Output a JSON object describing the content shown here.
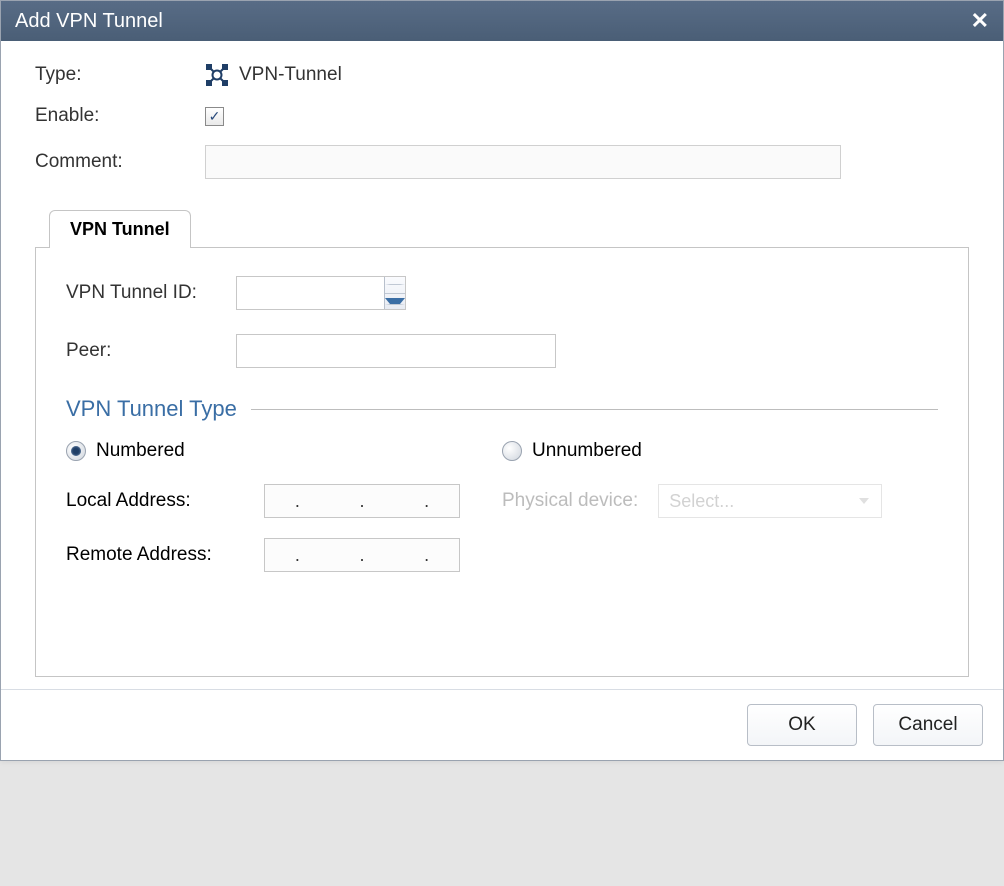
{
  "dialog": {
    "title": "Add VPN Tunnel"
  },
  "form": {
    "type_label": "Type:",
    "type_value": "VPN-Tunnel",
    "enable_label": "Enable:",
    "enable_checked": true,
    "comment_label": "Comment:",
    "comment_value": ""
  },
  "tab": {
    "label": "VPN Tunnel"
  },
  "panel": {
    "tunnel_id_label": "VPN Tunnel ID:",
    "tunnel_id_value": "",
    "peer_label": "Peer:",
    "peer_value": ""
  },
  "section": {
    "title": "VPN Tunnel Type"
  },
  "tunneltype": {
    "numbered_label": "Numbered",
    "unnumbered_label": "Unnumbered",
    "selected": "numbered",
    "local_label": "Local Address:",
    "local_value": ".   .   .",
    "remote_label": "Remote Address:",
    "remote_value": ".   .   .",
    "phys_label": "Physical device:",
    "phys_placeholder": "Select..."
  },
  "buttons": {
    "ok": "OK",
    "cancel": "Cancel"
  }
}
